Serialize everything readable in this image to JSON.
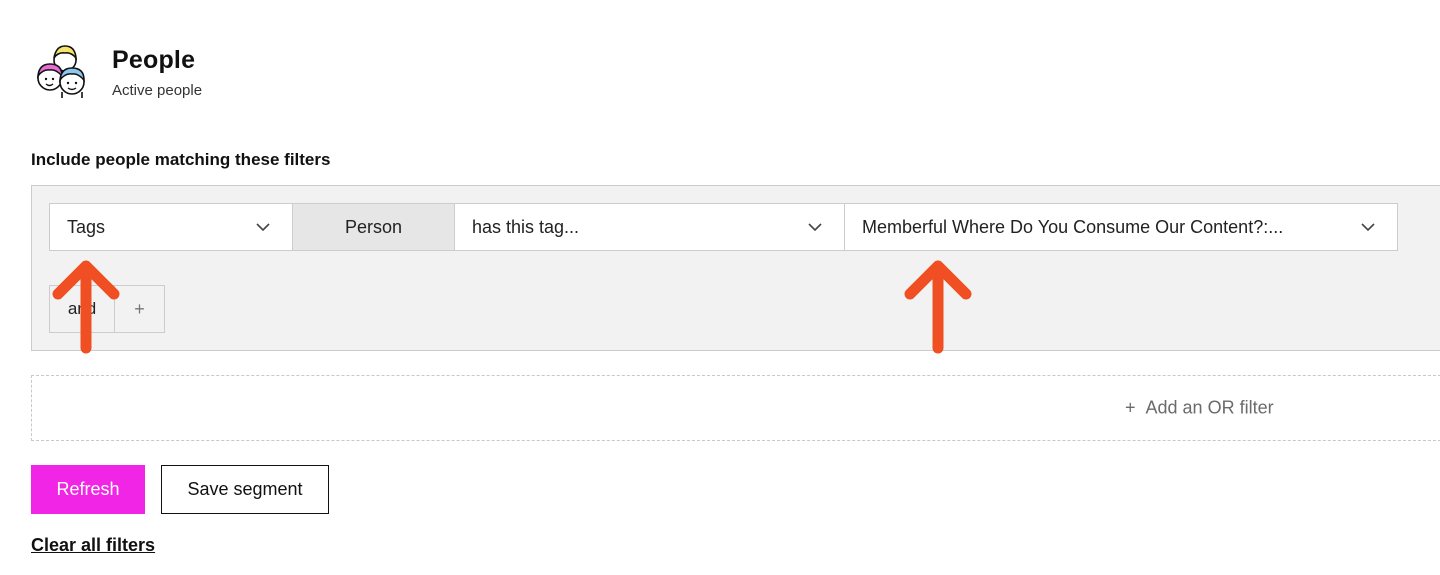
{
  "header": {
    "title": "People",
    "subtitle": "Active people",
    "logo_icon": "people-avatars-icon"
  },
  "filters": {
    "heading": "Include people matching these filters",
    "condition": {
      "field": "Tags",
      "scope": "Person",
      "operator": "has this tag...",
      "value": "Memberful Where Do You Consume Our Content?:..."
    },
    "and_label": "and",
    "add_label": "+"
  },
  "or_filter": {
    "plus": "+",
    "label": "Add an OR filter"
  },
  "actions": {
    "refresh": "Refresh",
    "save_segment": "Save segment",
    "clear_all": "Clear all filters"
  },
  "colors": {
    "accent": "#f025e6",
    "annotation_arrow": "#f04e23"
  }
}
